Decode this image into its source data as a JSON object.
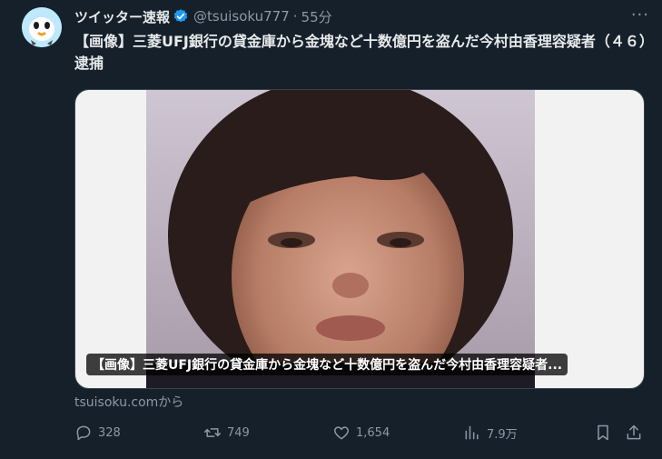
{
  "tweet": {
    "display_name": "ツイッター速報",
    "handle": "@tsuisoku777",
    "separator": "·",
    "time": "55分",
    "more_label": "···",
    "text": "【画像】三菱UFJ銀行の貸金庫から金塊など十数億円を盗んだ今村由香理容疑者（４６）逮捕",
    "card_caption": "【画像】三菱UFJ銀行の貸金庫から金塊など十数億円を盗んだ今村由香理容疑者...",
    "source": "tsuisoku.comから",
    "reply_count": "328",
    "retweet_count": "749",
    "like_count": "1,654",
    "view_count": "7.9万"
  },
  "colors": {
    "background": "#15202b",
    "text_primary": "#e7e9ea",
    "text_secondary": "#8b98a5",
    "verified_badge": "#1d9bf0",
    "avatar_bg": "#7fd3f7"
  }
}
